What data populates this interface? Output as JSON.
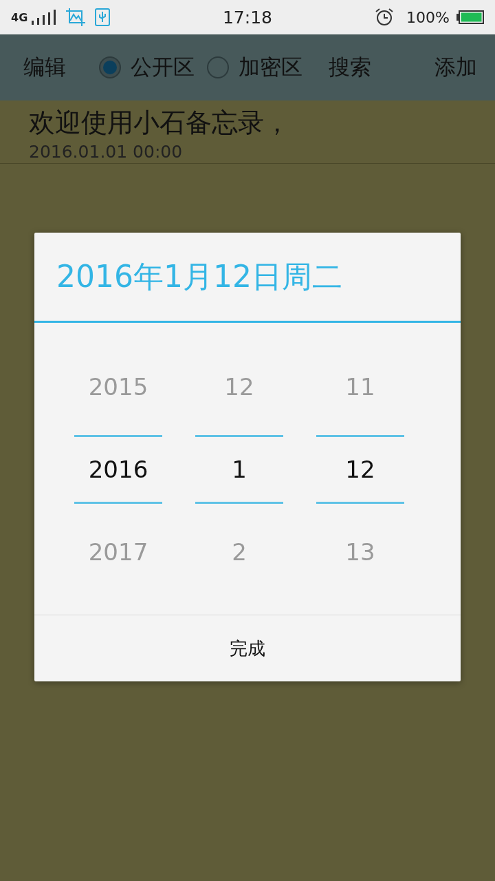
{
  "status_bar": {
    "network": "4G",
    "time": "17:18",
    "battery": "100%"
  },
  "toolbar": {
    "edit": "编辑",
    "zones": [
      {
        "label": "公开区",
        "selected": true
      },
      {
        "label": "加密区",
        "selected": false
      }
    ],
    "search": "搜索",
    "add": "添加"
  },
  "notes": [
    {
      "title": "欢迎使用小石备忘录，",
      "date": "2016.01.01 00:00"
    }
  ],
  "date_dialog": {
    "title": "2016年1月12日周二",
    "columns": [
      {
        "above": "2015",
        "value": "2016",
        "below": "2017"
      },
      {
        "above": "12",
        "value": "1",
        "below": "2"
      },
      {
        "above": "11",
        "value": "12",
        "below": "13"
      }
    ],
    "done": "完成"
  }
}
